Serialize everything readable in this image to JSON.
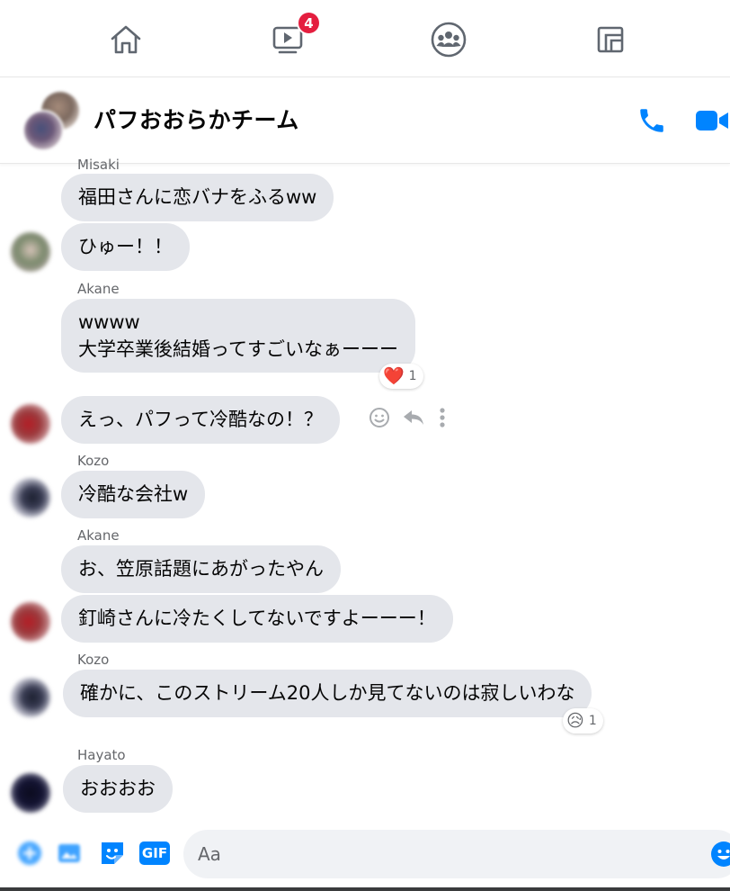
{
  "nav": {
    "items": [
      {
        "name": "home",
        "icon": "home-icon"
      },
      {
        "name": "watch",
        "icon": "video-icon",
        "badge": "4"
      },
      {
        "name": "groups",
        "icon": "groups-icon"
      },
      {
        "name": "gaming",
        "icon": "gaming-icon"
      }
    ],
    "badge_color": "#e41e3f"
  },
  "header": {
    "title": "パフおおらかチーム",
    "accent": "#0084ff"
  },
  "messages": [
    {
      "sender": "Misaki",
      "text": "福田さんに恋バナをふるww"
    },
    {
      "text": "ひゅー！！"
    },
    {
      "sender": "Akane",
      "text": "wwww\n大学卒業後結婚ってすごいなぁーーー",
      "reaction": {
        "emoji": "❤️",
        "count": "1"
      }
    },
    {
      "text": "えっ、パフって冷酷なの！？"
    },
    {
      "sender": "Kozo",
      "text": "冷酷な会社w"
    },
    {
      "sender": "Akane",
      "text": "お、笠原話題にあがったやん"
    },
    {
      "text": "釘崎さんに冷たくしてないですよーーー！"
    },
    {
      "sender": "Kozo",
      "text": "確かに、このストリーム20人しか見てないのは寂しいわな",
      "reaction": {
        "emoji": "😥",
        "count": "1"
      }
    },
    {
      "sender": "Hayato",
      "text": "おおおお"
    }
  ],
  "composer": {
    "placeholder": "Aa",
    "gif_label": "GIF"
  }
}
